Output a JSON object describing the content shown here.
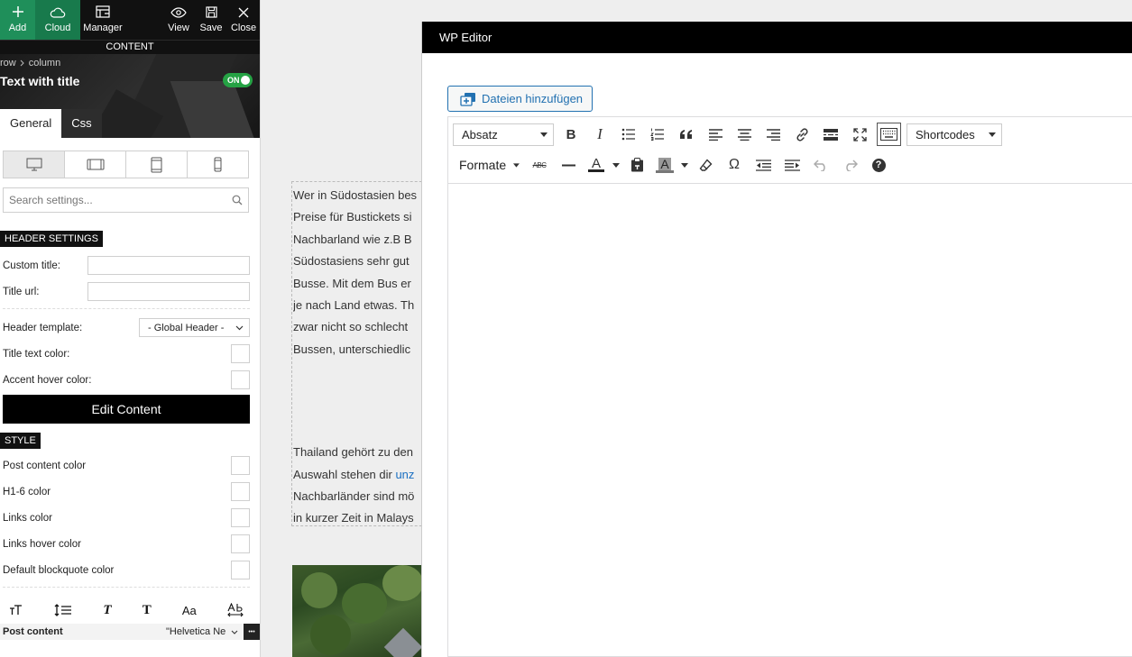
{
  "topbar": {
    "add_label": "Add",
    "cloud_label": "Cloud",
    "manager_label": "Manager",
    "view_label": "View",
    "save_label": "Save",
    "close_label": "Close",
    "strip_label": "CONTENT"
  },
  "hero": {
    "breadcrumb_row": "row",
    "breadcrumb_column": "column",
    "title": "Text with title",
    "toggle_label": "ON"
  },
  "tabs": [
    {
      "label": "General"
    },
    {
      "label": "Css"
    }
  ],
  "search": {
    "placeholder": "Search settings..."
  },
  "header_settings": {
    "section_label": "HEADER SETTINGS",
    "custom_title_label": "Custom title:",
    "title_url_label": "Title url:",
    "header_template_label": "Header template:",
    "header_template_value": "- Global Header -",
    "title_text_color_label": "Title text color:",
    "accent_hover_color_label": "Accent hover color:",
    "edit_content_label": "Edit Content"
  },
  "style": {
    "section_label": "STYLE",
    "post_content_color": "Post content color",
    "h16_color": "H1-6 color",
    "links_color": "Links color",
    "links_hover_color": "Links hover color",
    "blockquote_color": "Default blockquote color"
  },
  "typography": {
    "italic_glyph": "T",
    "bold_glyph": "T",
    "case_glyph": "Aa",
    "post_content_label": "Post content",
    "font_value": "\"Helvetica Ne",
    "more_glyph": "•••"
  },
  "preview": {
    "lines1": [
      "Wer in Südostasien bes",
      "Preise für Bustickets si",
      "Nachbarland wie z.B B",
      "Südostasiens sehr gut",
      "Busse. Mit dem Bus er",
      "je nach Land etwas. Th",
      "zwar nicht so schlecht",
      "Bussen, unterschiedlic"
    ],
    "line2_1": "Thailand gehört zu den",
    "line2_2_prefix": "Auswahl stehen dir ",
    "line2_2_link": "unz",
    "line2_3": "Nachbarländer sind mö",
    "line2_4": "in kurzer Zeit in Malays"
  },
  "modal": {
    "title": "WP Editor",
    "add_media_label": "Dateien hinzufügen",
    "format_select": "Absatz",
    "shortcodes_select": "Shortcodes",
    "formats_menu": "Formate",
    "strike_glyph": "ABC",
    "color_glyph": "A",
    "bgcolor_glyph": "A",
    "omega_glyph": "Ω",
    "help_glyph": "?"
  },
  "colors": {
    "accent_green": "#1f8f5a",
    "toggle_green": "#25a244",
    "link_blue": "#2271b1"
  }
}
